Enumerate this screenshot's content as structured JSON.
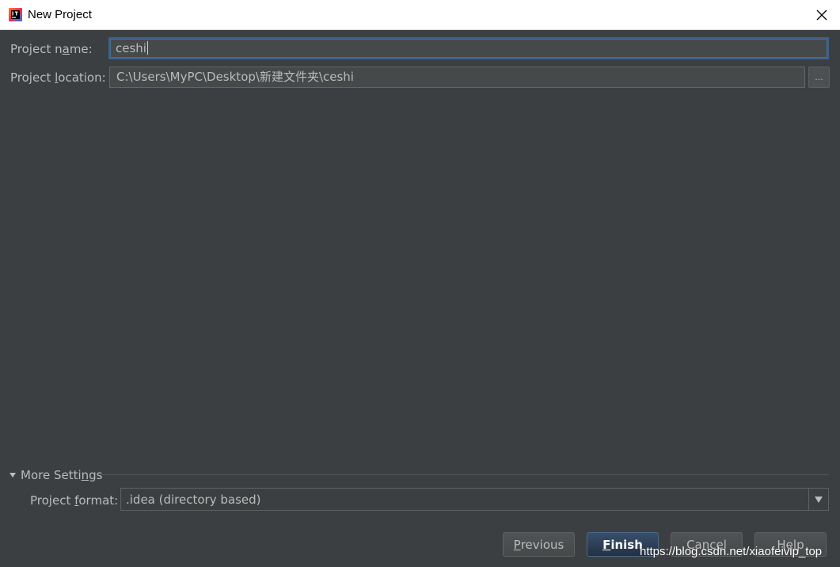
{
  "window": {
    "title": "New Project",
    "app_icon": "intellij-idea-icon",
    "close_icon": "close-icon"
  },
  "form": {
    "project_name": {
      "label_pre": "Project n",
      "label_mnemonic": "a",
      "label_post": "me:",
      "value": "ceshi"
    },
    "project_location": {
      "label_pre": "Project ",
      "label_mnemonic": "l",
      "label_post": "ocation:",
      "value": "C:\\Users\\MyPC\\Desktop\\新建文件夹\\ceshi",
      "browse_label": "..."
    }
  },
  "more_settings": {
    "label_pre": "More Setti",
    "label_mnemonic": "n",
    "label_post": "gs",
    "expanded": true,
    "project_format": {
      "label_pre": "Project ",
      "label_mnemonic": "f",
      "label_post": "ormat:",
      "value": ".idea (directory based)"
    }
  },
  "buttons": {
    "previous": {
      "mnemonic": "P",
      "rest": "revious"
    },
    "finish": {
      "mnemonic": "F",
      "rest": "inish"
    },
    "cancel": {
      "label": "Cancel"
    },
    "help": {
      "label": "Help"
    }
  },
  "watermark": "https://blog.csdn.net/xiaofeivip_top",
  "colors": {
    "background": "#3c3f41",
    "text": "#bbbbbb",
    "focus_border": "#3d6185",
    "default_button": "#2f4562"
  }
}
